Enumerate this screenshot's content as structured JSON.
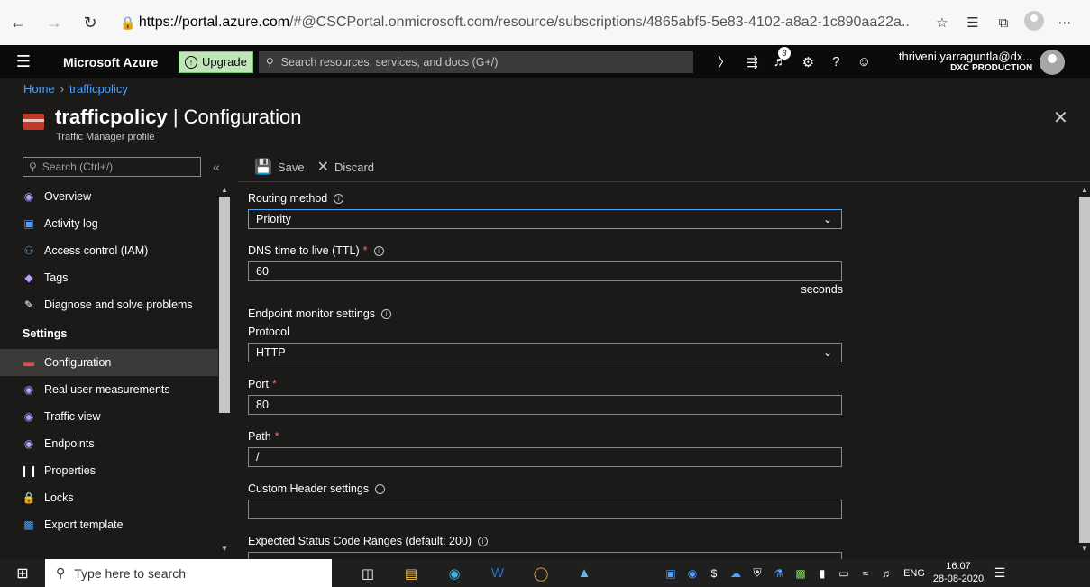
{
  "browser": {
    "url_host": "https://portal.azure.com",
    "url_rest": "/#@CSCPortal.onmicrosoft.com/resource/subscriptions/4865abf5-5e83-4102-a8a2-1c890aa22a..."
  },
  "azure_bar": {
    "brand": "Microsoft Azure",
    "upgrade_label": "Upgrade",
    "search_placeholder": "Search resources, services, and docs (G+/)",
    "notification_count": "3",
    "account_name": "thriveni.yarraguntla@dx...",
    "account_directory": "DXC PRODUCTION"
  },
  "breadcrumb": {
    "home": "Home",
    "current": "trafficpolicy"
  },
  "header": {
    "resource_name": "trafficpolicy",
    "separator": " | ",
    "blade_title": "Configuration",
    "subtitle": "Traffic Manager profile"
  },
  "left_nav": {
    "search_placeholder": "Search (Ctrl+/)",
    "items": [
      {
        "label": "Overview",
        "icon": "overview-icon"
      },
      {
        "label": "Activity log",
        "icon": "activity-log-icon"
      },
      {
        "label": "Access control (IAM)",
        "icon": "iam-icon"
      },
      {
        "label": "Tags",
        "icon": "tag-icon"
      },
      {
        "label": "Diagnose and solve problems",
        "icon": "wrench-icon"
      }
    ],
    "settings_heading": "Settings",
    "settings_items": [
      {
        "label": "Configuration",
        "icon": "configuration-icon"
      },
      {
        "label": "Real user measurements",
        "icon": "rum-icon"
      },
      {
        "label": "Traffic view",
        "icon": "traffic-view-icon"
      },
      {
        "label": "Endpoints",
        "icon": "endpoints-icon"
      },
      {
        "label": "Properties",
        "icon": "properties-icon"
      },
      {
        "label": "Locks",
        "icon": "lock-icon"
      },
      {
        "label": "Export template",
        "icon": "export-icon"
      }
    ]
  },
  "toolbar": {
    "save_label": "Save",
    "discard_label": "Discard"
  },
  "form": {
    "routing_method_label": "Routing method",
    "routing_method_value": "Priority",
    "ttl_label": "DNS time to live (TTL)",
    "ttl_value": "60",
    "ttl_units": "seconds",
    "monitor_label": "Endpoint monitor settings",
    "protocol_label": "Protocol",
    "protocol_value": "HTTP",
    "port_label": "Port",
    "port_value": "80",
    "path_label": "Path",
    "path_value": "/",
    "custom_header_label": "Custom Header settings",
    "custom_header_value": "",
    "status_codes_label": "Expected Status Code Ranges (default: 200)",
    "status_codes_value": ""
  },
  "taskbar": {
    "search_placeholder": "Type here to search",
    "language": "ENG",
    "time": "16:07",
    "date": "28-08-2020"
  }
}
